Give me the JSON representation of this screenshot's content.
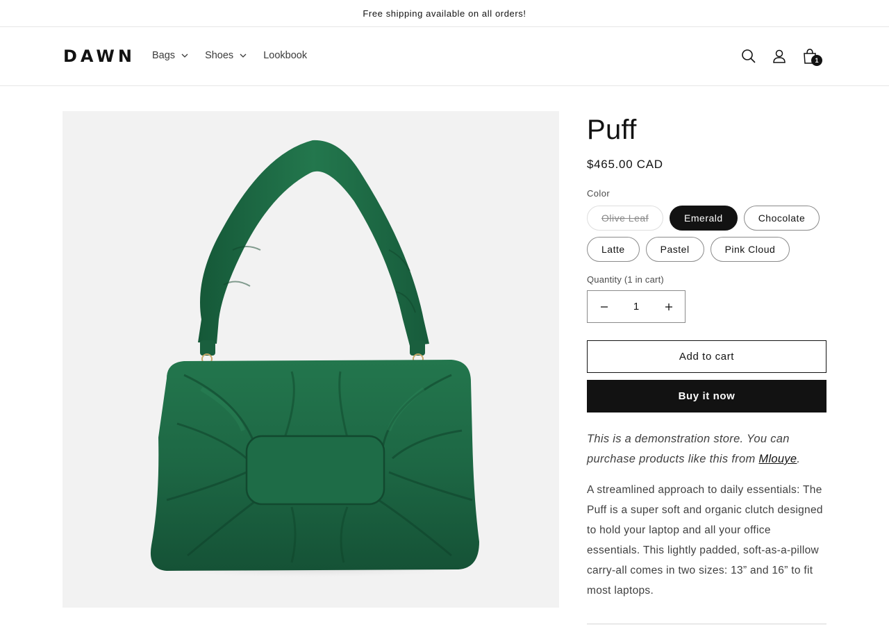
{
  "announcement": {
    "text": "Free shipping available on all orders!"
  },
  "header": {
    "logo": "DAWN",
    "nav": [
      {
        "label": "Bags",
        "has_dropdown": true
      },
      {
        "label": "Shoes",
        "has_dropdown": true
      },
      {
        "label": "Lookbook",
        "has_dropdown": false
      }
    ],
    "icons": [
      "search-icon",
      "account-icon",
      "cart-icon"
    ],
    "cart_count": "1"
  },
  "product": {
    "image": {
      "subject": "green-puff-bag",
      "color": "#1f6a45",
      "background": "#f2f2f2"
    },
    "title": "Puff",
    "price": "$465.00 CAD",
    "color_label": "Color",
    "colors": [
      {
        "label": "Olive Leaf",
        "state": "disabled"
      },
      {
        "label": "Emerald",
        "state": "selected"
      },
      {
        "label": "Chocolate",
        "state": "default"
      },
      {
        "label": "Latte",
        "state": "default"
      },
      {
        "label": "Pastel",
        "state": "default"
      },
      {
        "label": "Pink Cloud",
        "state": "default"
      }
    ],
    "quantity_label": "Quantity (1 in cart)",
    "quantity_value": "1",
    "add_to_cart": "Add to cart",
    "buy_now": "Buy it now",
    "demo_note_prefix": "This is a demonstration store. You can purchase products like this from ",
    "demo_note_link": "Mlouye",
    "demo_note_suffix": ".",
    "description": "A streamlined approach to daily essentials: The Puff is a super soft and organic clutch designed to hold your laptop and all your office essentials. This lightly padded, soft-as-a-pillow carry-all comes in two sizes: 13” and 16” to fit most laptops."
  },
  "colors": {
    "primary": "#121212",
    "border": "#8a8a8a",
    "bag_green": "#1f6a45"
  }
}
